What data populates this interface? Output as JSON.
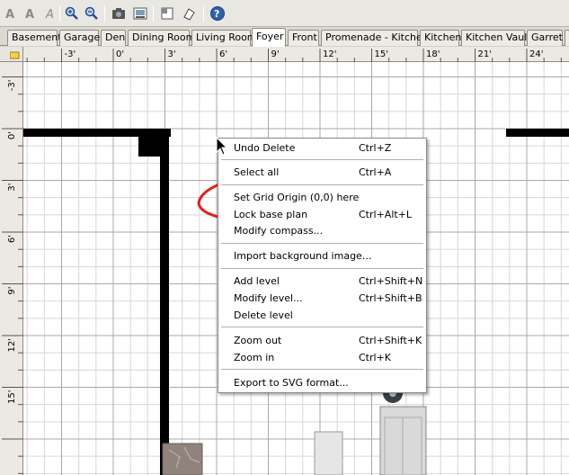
{
  "toolbar": {
    "icons": [
      "text-style-icon",
      "bold-text-icon",
      "italic-text-icon",
      "zoom-in-icon",
      "zoom-out-icon",
      "create-photo-icon",
      "create-video-icon",
      "add-furniture-icon",
      "export-icon",
      "help-icon"
    ]
  },
  "tabs": [
    "Basement",
    "Garage",
    "Den",
    "Dining Room",
    "Living Room",
    "Foyer",
    "Front",
    "Promenade - Kitchen",
    "Kitchen",
    "Kitchen Vault",
    "Garret"
  ],
  "active_tab": "Foyer",
  "rulers": {
    "top": [
      "-3'",
      "0'",
      "3'",
      "6'",
      "9'",
      "12'",
      "15'",
      "18'",
      "21'",
      "24'"
    ],
    "left": [
      "-3'",
      "0'",
      "3'",
      "6'",
      "9'",
      "12'",
      "15'"
    ]
  },
  "menu": {
    "undo": {
      "label": "Undo Delete",
      "shortcut": "Ctrl+Z"
    },
    "select_all": {
      "label": "Select all",
      "shortcut": "Ctrl+A"
    },
    "grid_origin": {
      "label": "Set Grid Origin (0,0) here"
    },
    "lock": {
      "label": "Lock base plan",
      "shortcut": "Ctrl+Alt+L"
    },
    "compass": {
      "label": "Modify compass..."
    },
    "bg_image": {
      "label": "Import background image..."
    },
    "add_level": {
      "label": "Add level",
      "shortcut": "Ctrl+Shift+N"
    },
    "modify_level": {
      "label": "Modify level...",
      "shortcut": "Ctrl+Shift+B"
    },
    "delete_level": {
      "label": "Delete level"
    },
    "zoom_out": {
      "label": "Zoom out",
      "shortcut": "Ctrl+Shift+K"
    },
    "zoom_in": {
      "label": "Zoom in",
      "shortcut": "Ctrl+K"
    },
    "export_svg": {
      "label": "Export to SVG format..."
    }
  },
  "colors": {
    "annotation": "#e0201a",
    "wall": "#000000",
    "grid": "#c8c8c8"
  }
}
